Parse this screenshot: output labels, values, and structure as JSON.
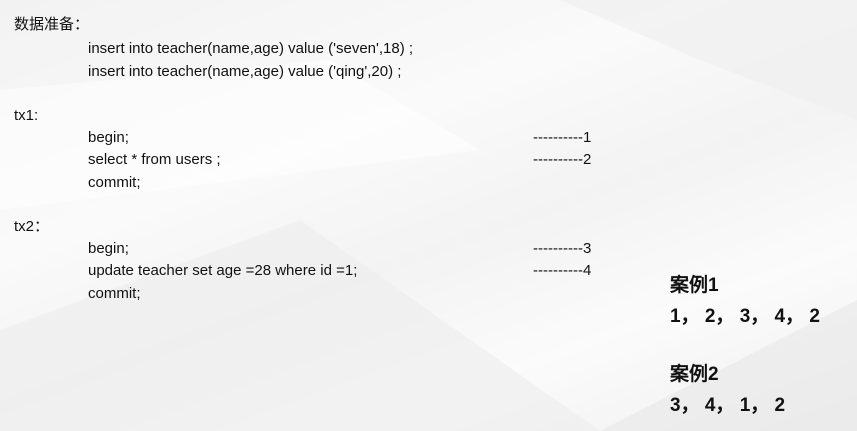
{
  "prep": {
    "title": "数据准备：",
    "lines": [
      "insert into teacher(name,age) value ('seven',18) ;",
      "insert into teacher(name,age) value ('qing',20) ;"
    ]
  },
  "tx1": {
    "title": "tx1:",
    "lines": [
      "begin;",
      "select * from users ;",
      "commit;"
    ],
    "steps": [
      "----------1",
      "----------2"
    ]
  },
  "tx2": {
    "title": "tx2：",
    "lines": [
      "begin;",
      "update teacher set age =28 where id =1;",
      "commit;"
    ],
    "steps": [
      "----------3",
      "----------4"
    ]
  },
  "cases": [
    {
      "title": "案例1",
      "order": "1， 2， 3， 4， 2"
    },
    {
      "title": "案例2",
      "order": "3， 4， 1， 2"
    }
  ]
}
